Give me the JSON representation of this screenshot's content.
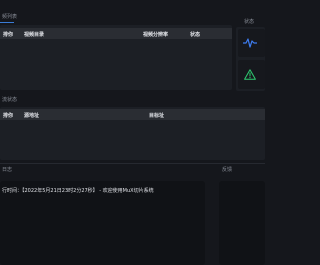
{
  "colors": {
    "accent": "#3a7bd5",
    "pulse": "#3d7cf0",
    "warning": "#2ecc71",
    "background": "#15171c",
    "panel": "#1c1f25"
  },
  "video_list": {
    "title": "频列表",
    "columns": [
      "排你",
      "视频目录",
      "视频分辨率",
      "状态"
    ]
  },
  "status_panel": {
    "title": "状态",
    "icons": [
      "pulse-icon",
      "warning-icon"
    ]
  },
  "stream_panel": {
    "title": "流状态",
    "columns": [
      "排你",
      "源地址",
      "目标址"
    ]
  },
  "log_panel": {
    "title": "日志",
    "line": "行时间：【2022年5月21日23时2分27秒】 - 欢迎使用MuX切片系统"
  },
  "aux_panel": {
    "title": "反馈"
  }
}
